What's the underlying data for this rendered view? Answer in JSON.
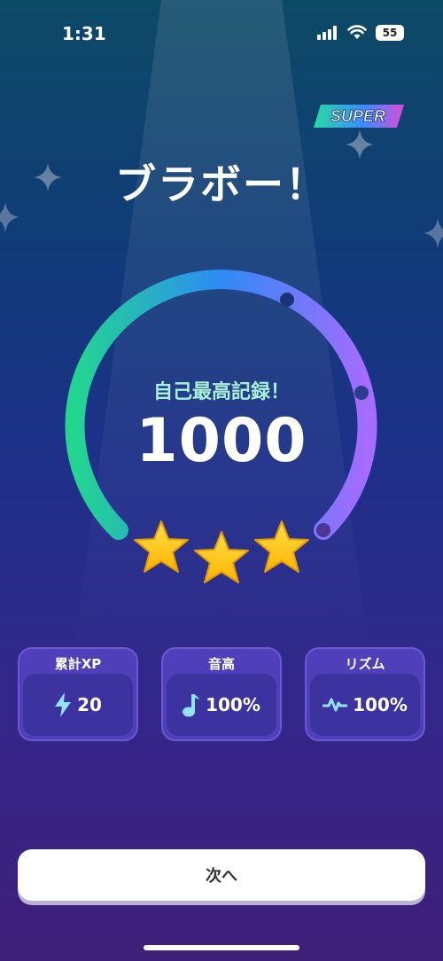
{
  "status_bar": {
    "time": "1:31",
    "battery": "55"
  },
  "badge": {
    "label": "SUPER"
  },
  "result": {
    "title": "ブラボー！",
    "subtitle": "自己最高記録！",
    "score": "1000",
    "stars": 3
  },
  "stats": [
    {
      "label": "累計XP",
      "value": "20",
      "icon": "lightning-icon"
    },
    {
      "label": "音高",
      "value": "100%",
      "icon": "music-note-icon"
    },
    {
      "label": "リズム",
      "value": "100%",
      "icon": "pulse-icon"
    }
  ],
  "actions": {
    "next_label": "次へ"
  },
  "colors": {
    "arc_start": "#22d68f",
    "arc_mid": "#2e8bf5",
    "arc_end": "#a66bff",
    "star": "#ffcc1a",
    "card_bg": "#4f3fb8"
  }
}
